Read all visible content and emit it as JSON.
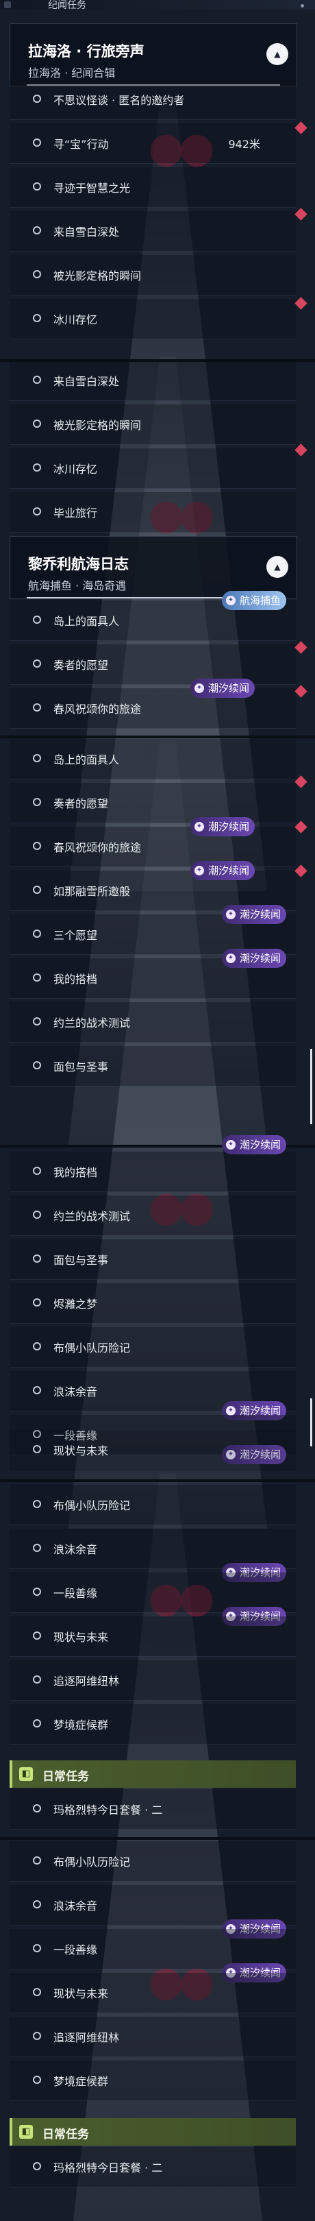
{
  "world_header": {
    "label": "纪闻任务"
  },
  "groups": {
    "lahailuo": {
      "title": "拉海洛 · 行旅旁声",
      "subtitle": "拉海洛 · 纪闻合辑"
    },
    "liqiaoli": {
      "title": "黎乔利航海日志",
      "subtitle": "航海捕鱼 · 海岛奇遇"
    }
  },
  "quests": {
    "q1": "不思议怪谈 · 匿名的邀约者",
    "q2": "寻“宝”行动",
    "q2_distance": "942米",
    "q3": "寻迹于智慧之光",
    "q4": "来自雪白深处",
    "q5": "被光影定格的瞬间",
    "q6": "冰川存忆",
    "q7": "毕业旅行",
    "q8": "岛上的面具人",
    "q9": "奏者的愿望",
    "q10": "春风祝颂你的旅途",
    "q11": "如那融雪所邀般",
    "q12": "三个愿望",
    "q13": "我的搭档",
    "q14": "约兰的战术测试",
    "q15": "面包与圣事",
    "q16": "烬灕之梦",
    "q17": "布偶小队历险记",
    "q18": "浪沫余音",
    "q19": "一段善缘",
    "q20": "现状与未来",
    "q21": "追逐阿维纽林",
    "q22": "梦境症候群",
    "q23": "玛格烈特今日套餐 · 二"
  },
  "badges": {
    "tide": "潮汐续闻",
    "fishing": "航海捕鱼"
  },
  "daily": {
    "label": "日常任务"
  },
  "colors": {
    "accent_red": "#d8455e",
    "badge_purple": "#6b47b3",
    "daily_green": "#b8d66b"
  }
}
